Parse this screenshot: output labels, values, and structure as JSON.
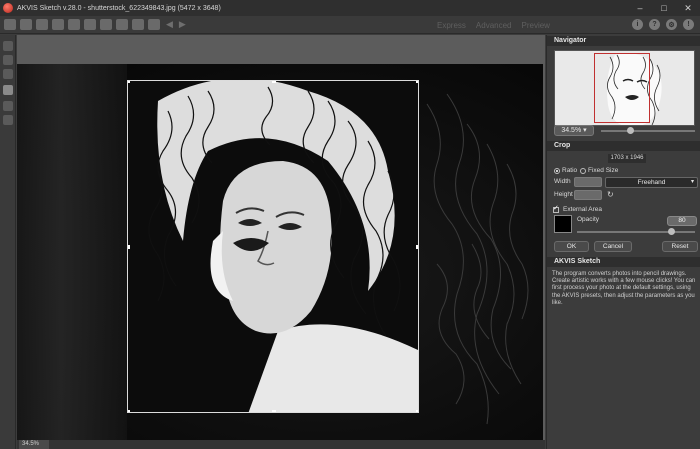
{
  "window": {
    "title": "AKVIS Sketch v.28.0 - shutterstock_622349843.jpg (5472 x 3648)",
    "controls": [
      "–",
      "□",
      "✕"
    ]
  },
  "toolbar": {
    "mode_tabs": [
      "Express",
      "Advanced",
      "Preview"
    ],
    "right_icons": [
      "info-icon",
      "help-icon",
      "settings-icon",
      "notification-icon"
    ]
  },
  "left_tools": [
    "brush-icon",
    "eraser-icon",
    "smudge-icon",
    "crop-icon",
    "hand-icon",
    "zoom-icon"
  ],
  "navigator": {
    "title": "Navigator",
    "zoom": "34.5%"
  },
  "crop": {
    "title": "Crop",
    "dimensions": "1703 x 1946",
    "ratio_label": "Ratio",
    "fixed_size_label": "Fixed Size",
    "width_label": "Width",
    "height_label": "Height",
    "mode": "Freehand",
    "external_area_label": "External Area",
    "external_area_checked": true,
    "opacity_label": "Opacity",
    "opacity_value": "80",
    "fill_color": "#000000",
    "ok_label": "OK",
    "cancel_label": "Cancel",
    "reset_label": "Reset"
  },
  "help": {
    "title": "AKVIS Sketch",
    "text": "The program converts photos into pencil drawings. Create artistic works with a few mouse clicks! You can first process your photo at the default settings, using the AKVIS presets, then adjust the parameters as you like."
  },
  "status": {
    "zoom": "34.5%"
  }
}
